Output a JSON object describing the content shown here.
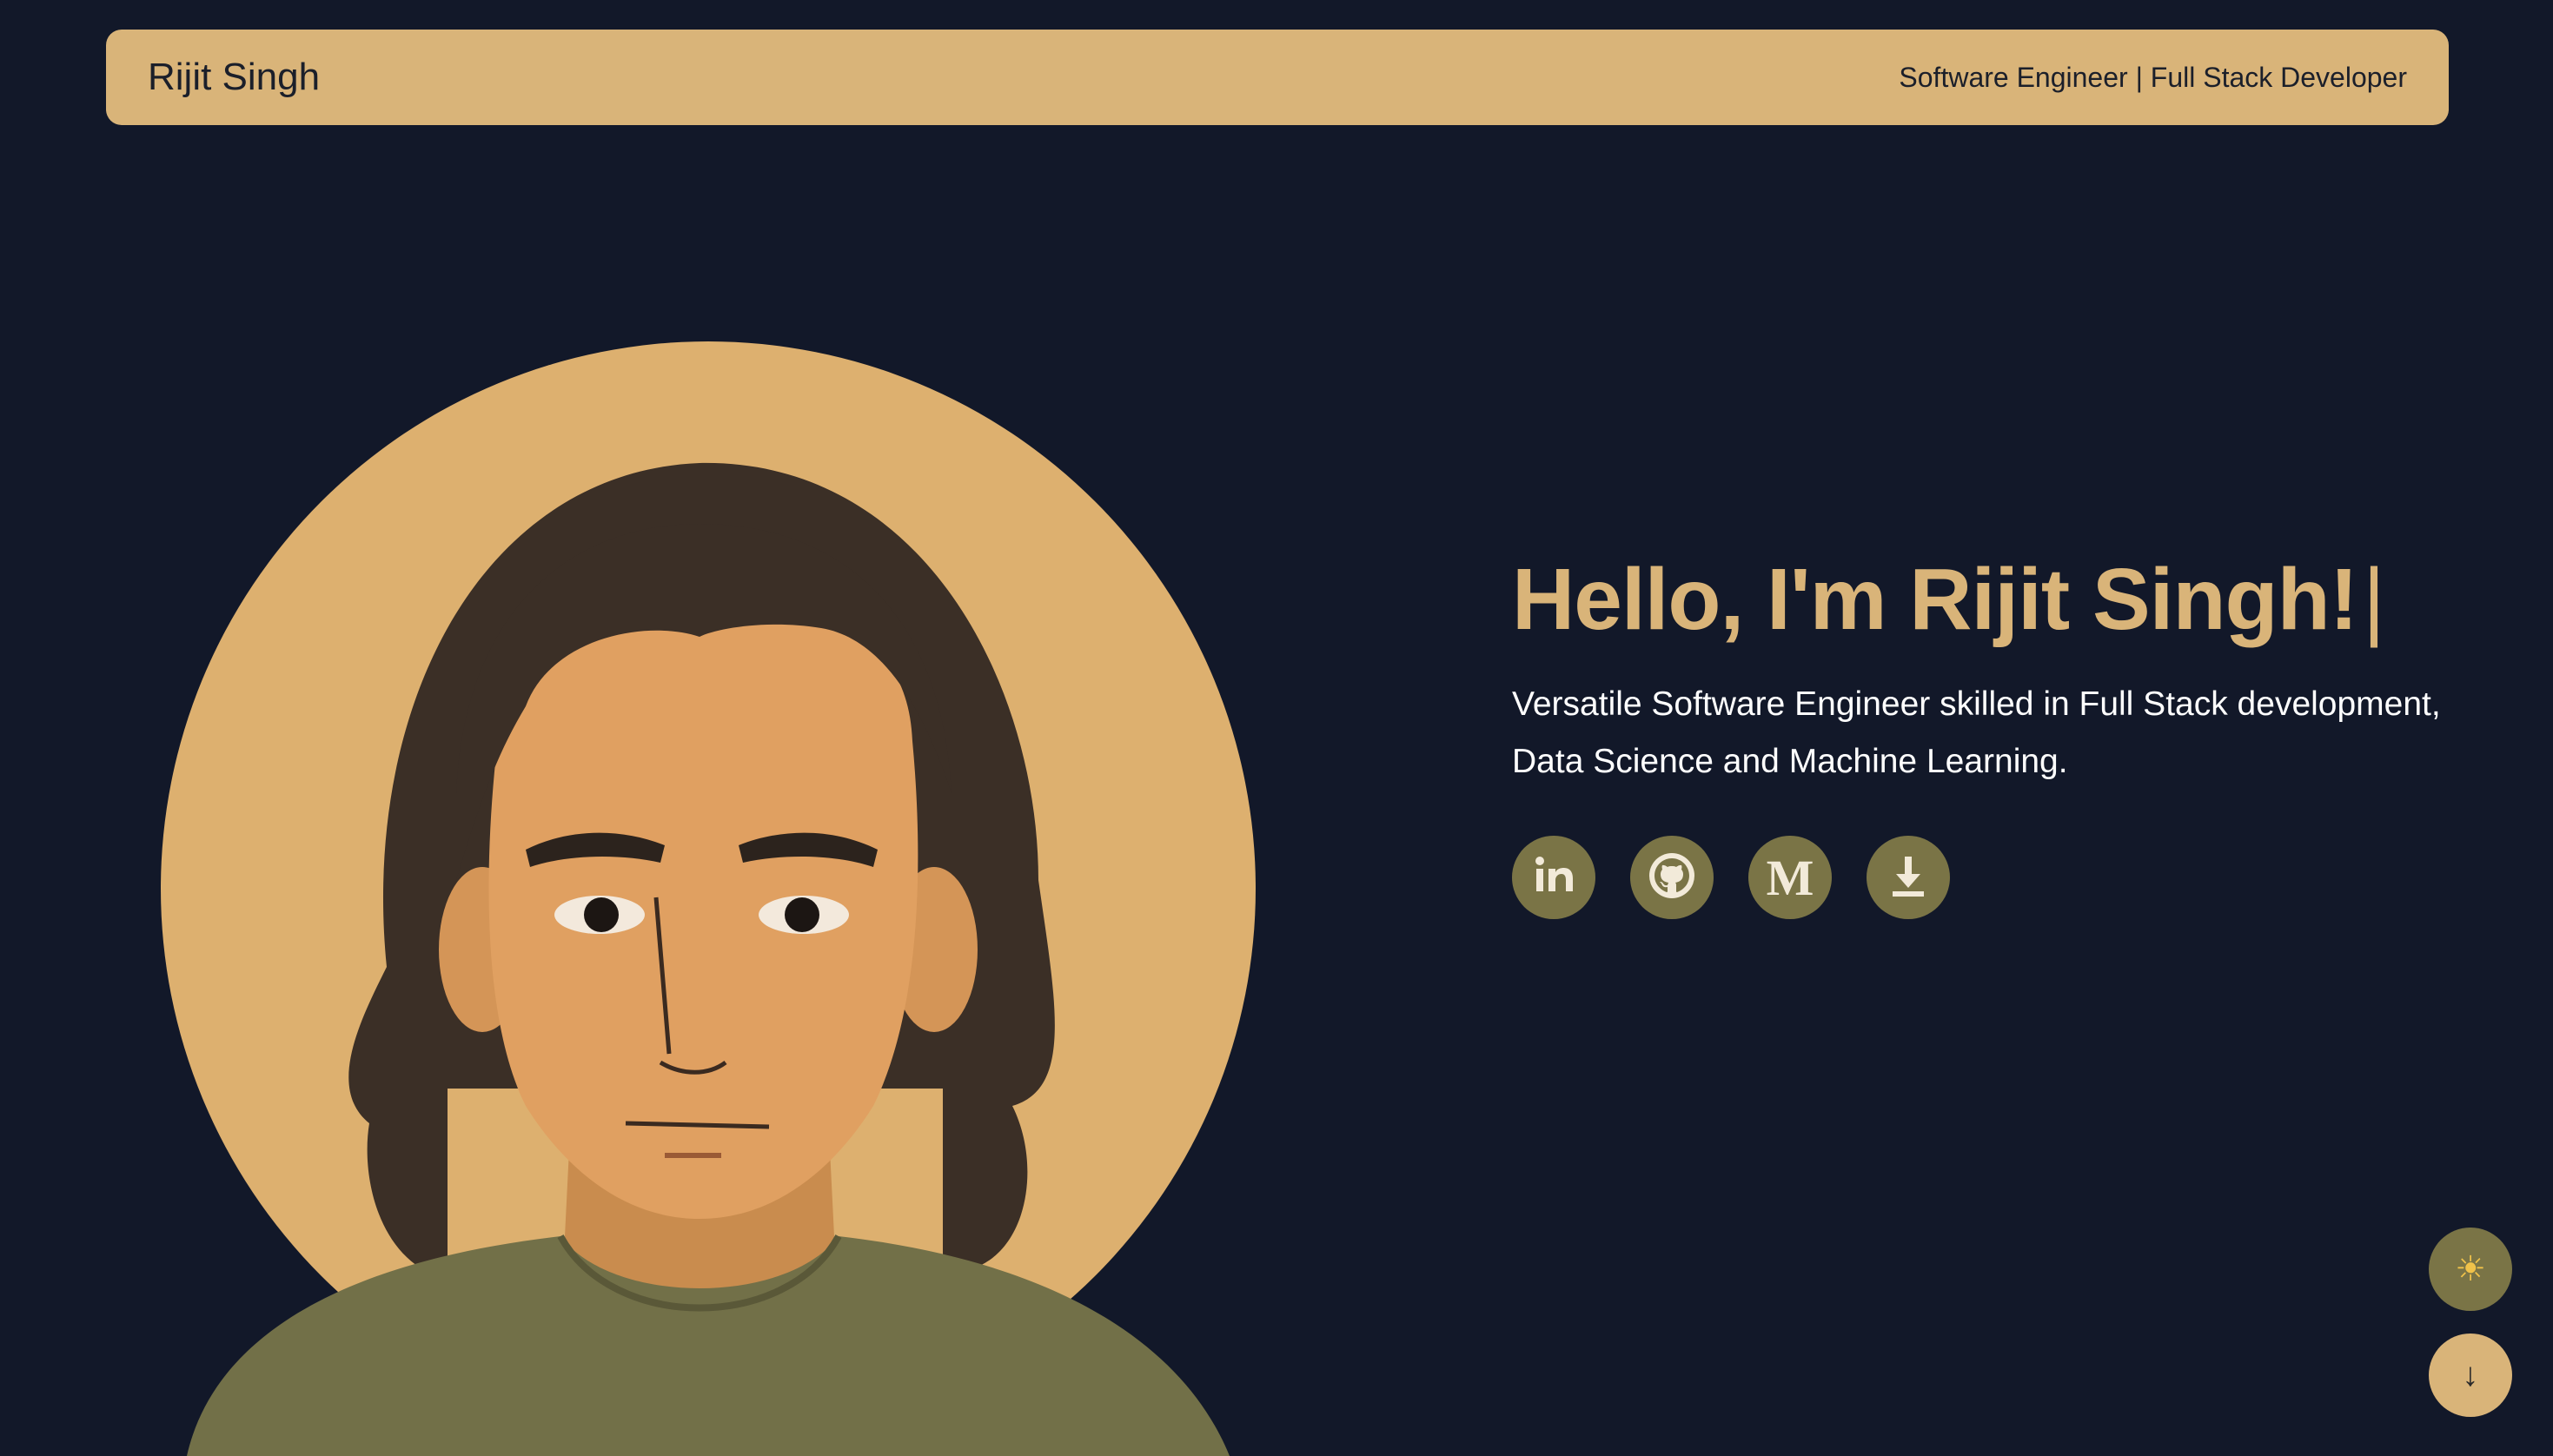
{
  "header": {
    "brand": "Rijit Singh",
    "tagline": "Software Engineer | Full Stack Developer"
  },
  "hero": {
    "greeting": "Hello, I'm Rijit Singh!",
    "caret": "|",
    "description": "Versatile Software Engineer skilled in Full Stack development, Data Science and Machine Learning."
  },
  "socials": [
    {
      "name": "linkedin-icon",
      "label": "in"
    },
    {
      "name": "github-icon"
    },
    {
      "name": "medium-icon",
      "label": "M"
    },
    {
      "name": "download-icon"
    }
  ],
  "controls": {
    "theme_toggle_icon": "sun-icon",
    "theme_glyph": "☀",
    "scroll_down_icon": "arrow-down-icon",
    "scroll_glyph": "↓"
  },
  "colors": {
    "background": "#121829",
    "accent": "#d9b479",
    "icon_bg": "#7a7446",
    "text": "#ffffff"
  }
}
